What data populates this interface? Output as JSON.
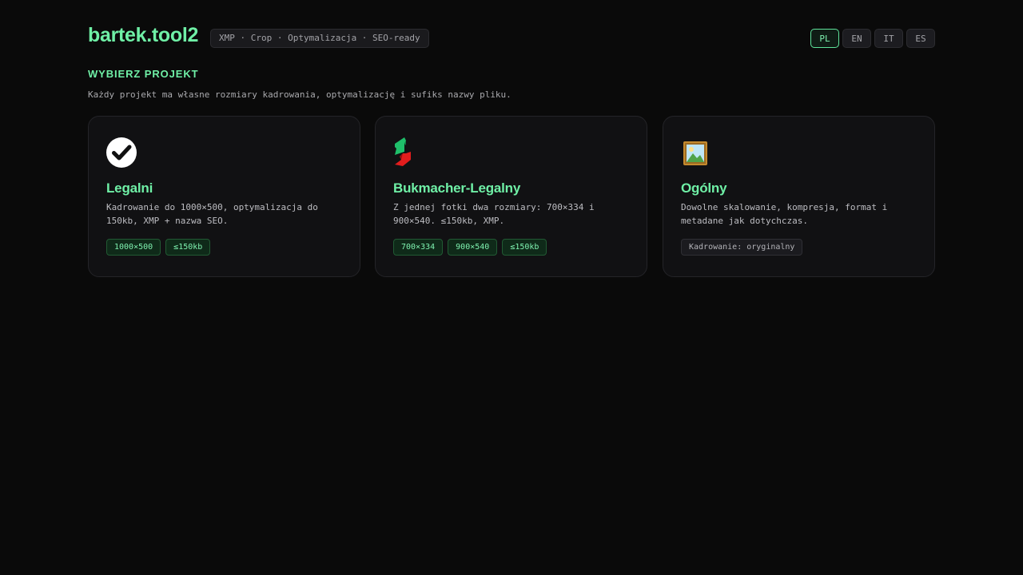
{
  "header": {
    "brand": "bartek.tool2",
    "tagline": "XMP · Crop · Optymalizacja · SEO-ready",
    "languages": [
      "PL",
      "EN",
      "IT",
      "ES"
    ],
    "active_language": "PL"
  },
  "section": {
    "title": "WYBIERZ PROJEKT",
    "description": "Każdy projekt ma własne rozmiary kadrowania, optymalizację i sufiks nazwy pliku."
  },
  "projects": [
    {
      "icon": "check-circle-icon",
      "name": "Legalni",
      "description": "Kadrowanie do 1000×500, optymalizacja do 150kb, XMP + nazwa SEO.",
      "tags": [
        "1000×500",
        "≤150kb"
      ]
    },
    {
      "icon": "bookmaker-logo-icon",
      "name": "Bukmacher-Legalny",
      "description": "Z jednej fotki dwa rozmiary: 700×334 i 900×540. ≤150kb, XMP.",
      "tags": [
        "700×334",
        "900×540",
        "≤150kb"
      ]
    },
    {
      "icon": "framed-picture-icon",
      "name": "Ogólny",
      "description": "Dowolne skalowanie, kompresja, format i metadane jak dotychczas.",
      "tags": [
        "Kadrowanie: oryginalny"
      ]
    }
  ],
  "colors": {
    "background": "#0a0a0a",
    "accent": "#6ff0a6",
    "card": "#111113",
    "tag_bg": "#0f2a19"
  }
}
